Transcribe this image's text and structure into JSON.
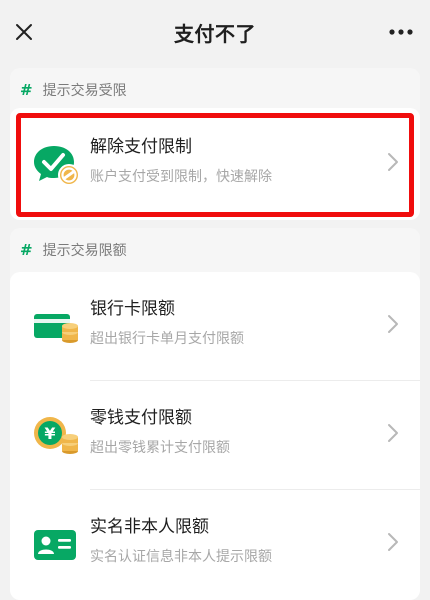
{
  "header": {
    "title": "支付不了"
  },
  "sections": [
    {
      "title": "提示交易受限",
      "items": [
        {
          "title": "解除支付限制",
          "subtitle": "账户支付受到限制，快速解除",
          "icon": "wechat-restricted-icon"
        }
      ]
    },
    {
      "title": "提示交易限额",
      "items": [
        {
          "title": "银行卡限额",
          "subtitle": "超出银行卡单月支付限额",
          "icon": "bank-card-coins-icon"
        },
        {
          "title": "零钱支付限额",
          "subtitle": "超出零钱累计支付限额",
          "icon": "yuan-coins-icon"
        },
        {
          "title": "实名非本人限额",
          "subtitle": "实名认证信息非本人提示限额",
          "icon": "id-card-icon"
        }
      ]
    }
  ],
  "colors": {
    "accent_green": "#07a864",
    "highlight_red": "#f00d0d",
    "coin_gold": "#f0b64a"
  }
}
